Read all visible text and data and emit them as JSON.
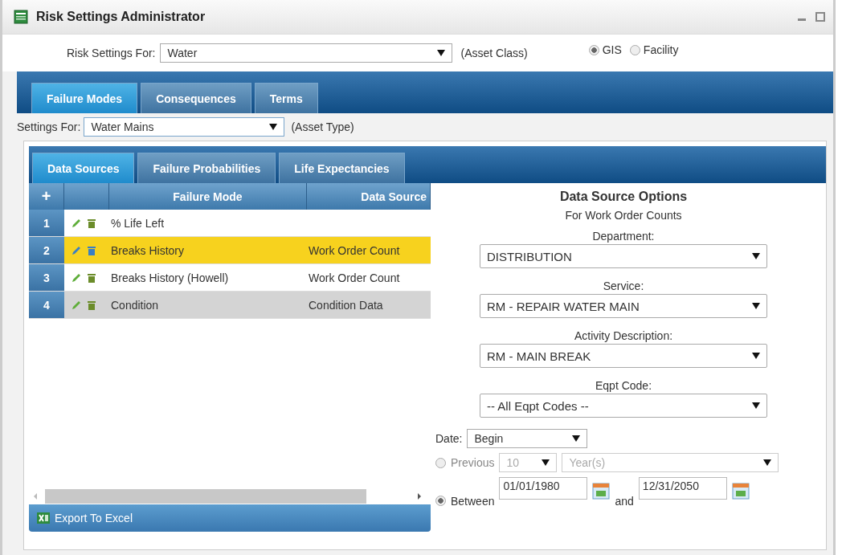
{
  "window": {
    "title": "Risk Settings Administrator"
  },
  "risk_settings": {
    "label": "Risk Settings For:",
    "value": "Water",
    "hint": "(Asset Class)",
    "options": [
      {
        "label": "GIS",
        "selected": true
      },
      {
        "label": "Facility",
        "selected": false
      }
    ]
  },
  "main_tabs": [
    {
      "label": "Failure Modes",
      "selected": true
    },
    {
      "label": "Consequences",
      "selected": false
    },
    {
      "label": "Terms",
      "selected": false
    }
  ],
  "settings_for": {
    "label": "Settings For:",
    "value": "Water Mains",
    "hint": "(Asset Type)"
  },
  "sub_tabs": [
    {
      "label": "Data Sources",
      "selected": true
    },
    {
      "label": "Failure Probabilities",
      "selected": false
    },
    {
      "label": "Life Expectancies",
      "selected": false
    }
  ],
  "grid": {
    "add": "+",
    "columns": [
      "Failure Mode",
      "Data Source"
    ],
    "rows": [
      {
        "number": "1",
        "failure_mode": "% Life Left",
        "data_source": "",
        "selected": false,
        "hovered": false
      },
      {
        "number": "2",
        "failure_mode": "Breaks History",
        "data_source": "Work Order Count",
        "selected": true,
        "hovered": false
      },
      {
        "number": "3",
        "failure_mode": "Breaks History (Howell)",
        "data_source": "Work Order Count",
        "selected": false,
        "hovered": false
      },
      {
        "number": "4",
        "failure_mode": "Condition",
        "data_source": "Condition Data",
        "selected": false,
        "hovered": true
      }
    ],
    "export": "Export To Excel"
  },
  "options_panel": {
    "title": "Data Source Options",
    "subtitle": "For Work Order Counts",
    "fields": [
      {
        "label": "Department:",
        "value": "DISTRIBUTION"
      },
      {
        "label": "Service:",
        "value": "RM - REPAIR WATER MAIN"
      },
      {
        "label": "Activity Description:",
        "value": "RM - MAIN BREAK"
      },
      {
        "label": "Eqpt Code:",
        "value": "-- All Eqpt Codes --"
      }
    ],
    "date": {
      "label": "Date:",
      "value": "Begin"
    },
    "previous": {
      "label": "Previous",
      "selected": false,
      "count": "10",
      "unit": "Year(s)"
    },
    "between": {
      "label": "Between",
      "selected": true,
      "from": "01/01/1980",
      "joiner": "and",
      "to": "12/31/2050"
    }
  }
}
